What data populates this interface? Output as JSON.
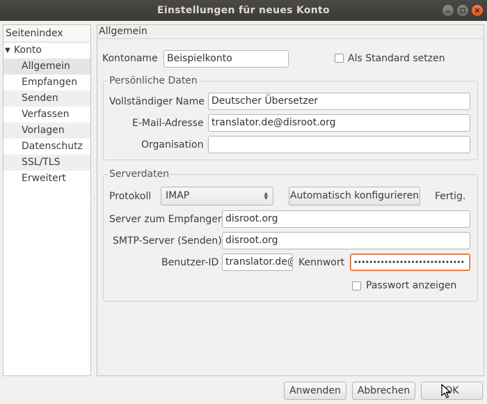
{
  "window": {
    "title": "Einstellungen für neues Konto"
  },
  "sidebar": {
    "header": "Seitenindex",
    "root": "Konto",
    "items": [
      {
        "label": "Allgemein"
      },
      {
        "label": "Empfangen"
      },
      {
        "label": "Senden"
      },
      {
        "label": "Verfassen"
      },
      {
        "label": "Vorlagen"
      },
      {
        "label": "Datenschutz"
      },
      {
        "label": "SSL/TLS"
      },
      {
        "label": "Erweitert"
      }
    ]
  },
  "content": {
    "header": "Allgemein",
    "account_name_label": "Kontoname",
    "account_name_value": "Beispielkonto",
    "default_checkbox_label": "Als Standard setzen",
    "personal": {
      "title": "Persönliche Daten",
      "fullname_label": "Vollständiger Name",
      "fullname_value": "Deutscher Übersetzer",
      "email_label": "E-Mail-Adresse",
      "email_value": "translator.de@disroot.org",
      "org_label": "Organisation",
      "org_value": ""
    },
    "server": {
      "title": "Serverdaten",
      "protocol_label": "Protokoll",
      "protocol_value": "IMAP",
      "autoconfig_button": "Automatisch konfigurieren",
      "status": "Fertig.",
      "incoming_label": "Server zum Empfangen",
      "incoming_value": "disroot.org",
      "smtp_label": "SMTP-Server (Senden)",
      "smtp_value": "disroot.org",
      "userid_label": "Benutzer-ID",
      "userid_value": "translator.de@",
      "password_label": "Kennwort",
      "password_value": "•••••••••••••••••••••••••••••",
      "show_password_label": "Passwort anzeigen"
    }
  },
  "footer": {
    "apply": "Anwenden",
    "cancel": "Abbrechen",
    "ok": "OK"
  }
}
